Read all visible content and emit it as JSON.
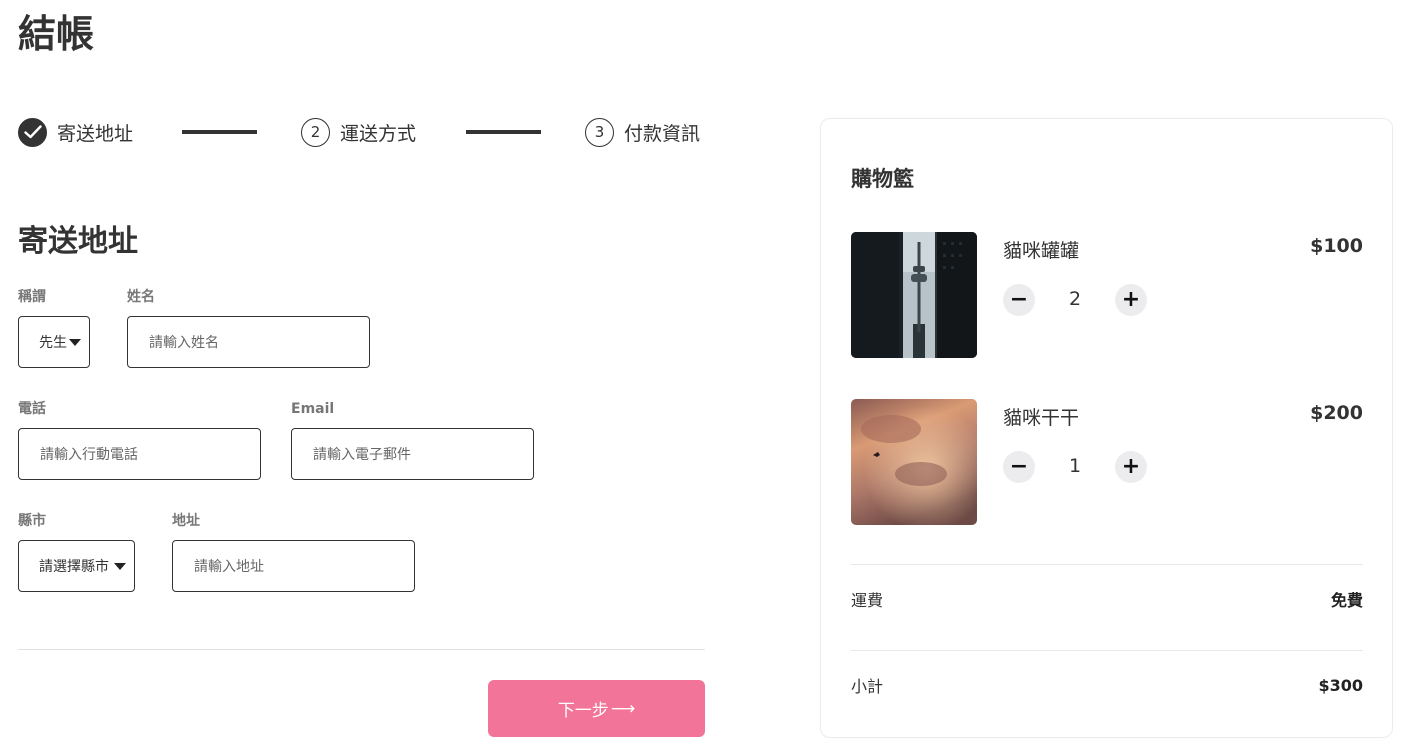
{
  "page": {
    "title": "結帳"
  },
  "stepper": {
    "steps": [
      {
        "label": "寄送地址",
        "number": "",
        "status": "done"
      },
      {
        "label": "運送方式",
        "number": "2",
        "status": "pending"
      },
      {
        "label": "付款資訊",
        "number": "3",
        "status": "pending"
      }
    ]
  },
  "form": {
    "section_title": "寄送地址",
    "salutation": {
      "label": "稱謂",
      "value": "先生"
    },
    "name": {
      "label": "姓名",
      "placeholder": "請輸入姓名"
    },
    "phone": {
      "label": "電話",
      "placeholder": "請輸入行動電話"
    },
    "email": {
      "label": "Email",
      "placeholder": "請輸入電子郵件"
    },
    "city": {
      "label": "縣市",
      "value": "請選擇縣市"
    },
    "address": {
      "label": "地址",
      "placeholder": "請輸入地址"
    },
    "next_label": "下一步",
    "next_arrow": "⟶"
  },
  "cart": {
    "title": "購物籃",
    "items": [
      {
        "name": "貓咪罐罐",
        "price": "$100",
        "quantity": "2",
        "minus": "−",
        "plus": "+"
      },
      {
        "name": "貓咪干干",
        "price": "$200",
        "quantity": "1",
        "minus": "−",
        "plus": "+"
      }
    ],
    "shipping": {
      "label": "運費",
      "value": "免費"
    },
    "subtotal": {
      "label": "小計",
      "value": "$300"
    }
  },
  "colors": {
    "accent": "#f37499",
    "text": "#333333",
    "border": "#333333"
  }
}
